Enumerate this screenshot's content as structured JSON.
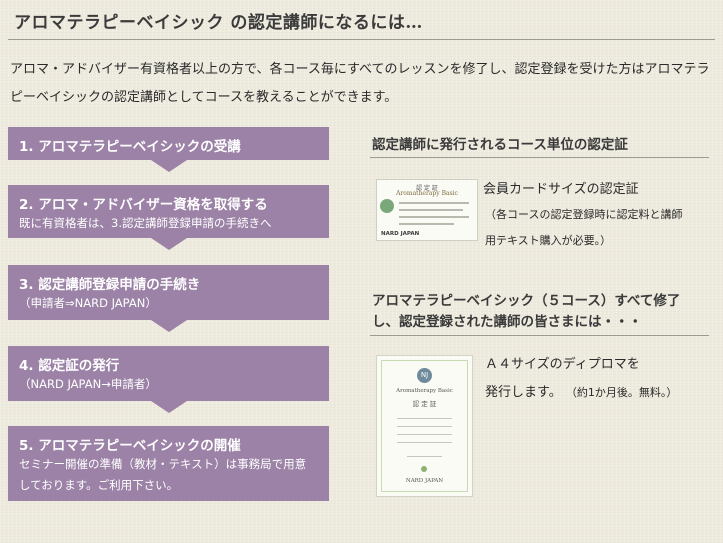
{
  "header": {
    "title": "アロマテラピーベイシック の認定講師になるには…"
  },
  "intro": {
    "text": "アロマ・アドバイザー有資格者以上の方で、各コース毎にすべてのレッスンを修了し、認定登録を受けた方はアロマテラピーベイシックの認定講師としてコースを教えることができます。"
  },
  "steps": [
    {
      "title": "1. アロマテラピーベイシックの受講",
      "sub": []
    },
    {
      "title": "2. アロマ・アドバイザー資格を取得する",
      "sub": [
        "既に有資格者は、3.認定講師登録申請の手続きへ"
      ]
    },
    {
      "title": "3. 認定講師登録申請の手続き",
      "sub": [
        "（申請者⇒NARD JAPAN）"
      ]
    },
    {
      "title": "4. 認定証の発行",
      "sub": [
        "（NARD JAPAN→申請者）"
      ]
    },
    {
      "title": "5. アロマテラピーベイシックの開催",
      "sub": [
        "セミナー開催の準備（教材・テキスト）は事務局で用意",
        "しております。ご利用下さい。"
      ]
    }
  ],
  "right": {
    "section1_heading": "認定講師に発行されるコース単位の認定証",
    "card_text": "会員カードサイズの認定証",
    "card_note_line1": "（各コースの認定登録時に認定料と講師",
    "card_note_line2": "用テキスト購入が必要。）",
    "section2_heading_line1": "アロマテラピーベイシック（５コース）すべて修了",
    "section2_heading_line2": "し、認定登録された講師の皆さまには・・・",
    "diploma_text_line1": "Ａ４サイズのディプロマを",
    "diploma_text_line2": "発行します。",
    "diploma_note": "（約1か月後。無料。）",
    "card_image": {
      "heading": "認 定 証",
      "subtitle": "Aromatherapy Basic",
      "footer": "NARD JAPAN"
    },
    "diploma_image": {
      "seal": "NJ",
      "subtitle": "Aromatherapy Basic",
      "heading": "認 定 証",
      "footer": "NARD JAPAN"
    }
  },
  "colors": {
    "background": "#eeebde",
    "step_fill": "#9b82a6",
    "rule": "#9c9a92"
  }
}
